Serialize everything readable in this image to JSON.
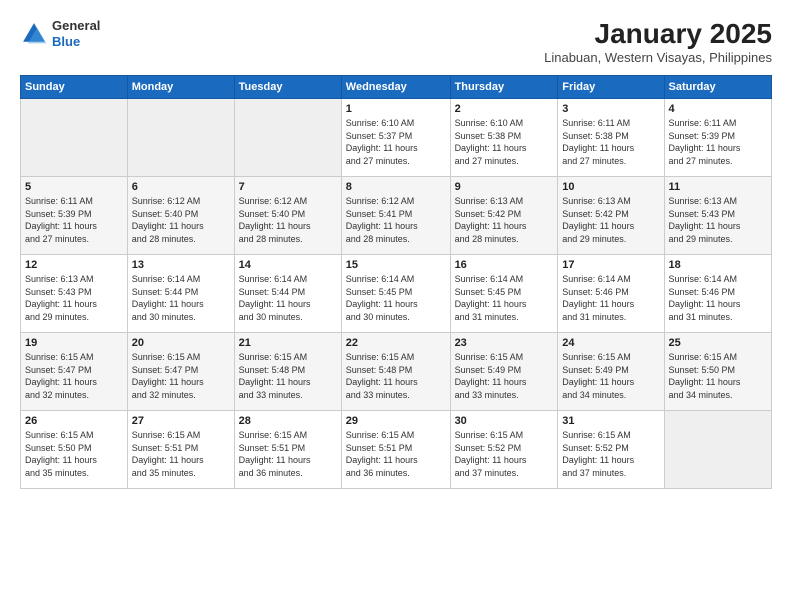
{
  "header": {
    "logo_general": "General",
    "logo_blue": "Blue",
    "month_title": "January 2025",
    "location": "Linabuan, Western Visayas, Philippines"
  },
  "days_of_week": [
    "Sunday",
    "Monday",
    "Tuesday",
    "Wednesday",
    "Thursday",
    "Friday",
    "Saturday"
  ],
  "weeks": [
    [
      {
        "day": "",
        "info": ""
      },
      {
        "day": "",
        "info": ""
      },
      {
        "day": "",
        "info": ""
      },
      {
        "day": "1",
        "info": "Sunrise: 6:10 AM\nSunset: 5:37 PM\nDaylight: 11 hours\nand 27 minutes."
      },
      {
        "day": "2",
        "info": "Sunrise: 6:10 AM\nSunset: 5:38 PM\nDaylight: 11 hours\nand 27 minutes."
      },
      {
        "day": "3",
        "info": "Sunrise: 6:11 AM\nSunset: 5:38 PM\nDaylight: 11 hours\nand 27 minutes."
      },
      {
        "day": "4",
        "info": "Sunrise: 6:11 AM\nSunset: 5:39 PM\nDaylight: 11 hours\nand 27 minutes."
      }
    ],
    [
      {
        "day": "5",
        "info": "Sunrise: 6:11 AM\nSunset: 5:39 PM\nDaylight: 11 hours\nand 27 minutes."
      },
      {
        "day": "6",
        "info": "Sunrise: 6:12 AM\nSunset: 5:40 PM\nDaylight: 11 hours\nand 28 minutes."
      },
      {
        "day": "7",
        "info": "Sunrise: 6:12 AM\nSunset: 5:40 PM\nDaylight: 11 hours\nand 28 minutes."
      },
      {
        "day": "8",
        "info": "Sunrise: 6:12 AM\nSunset: 5:41 PM\nDaylight: 11 hours\nand 28 minutes."
      },
      {
        "day": "9",
        "info": "Sunrise: 6:13 AM\nSunset: 5:42 PM\nDaylight: 11 hours\nand 28 minutes."
      },
      {
        "day": "10",
        "info": "Sunrise: 6:13 AM\nSunset: 5:42 PM\nDaylight: 11 hours\nand 29 minutes."
      },
      {
        "day": "11",
        "info": "Sunrise: 6:13 AM\nSunset: 5:43 PM\nDaylight: 11 hours\nand 29 minutes."
      }
    ],
    [
      {
        "day": "12",
        "info": "Sunrise: 6:13 AM\nSunset: 5:43 PM\nDaylight: 11 hours\nand 29 minutes."
      },
      {
        "day": "13",
        "info": "Sunrise: 6:14 AM\nSunset: 5:44 PM\nDaylight: 11 hours\nand 30 minutes."
      },
      {
        "day": "14",
        "info": "Sunrise: 6:14 AM\nSunset: 5:44 PM\nDaylight: 11 hours\nand 30 minutes."
      },
      {
        "day": "15",
        "info": "Sunrise: 6:14 AM\nSunset: 5:45 PM\nDaylight: 11 hours\nand 30 minutes."
      },
      {
        "day": "16",
        "info": "Sunrise: 6:14 AM\nSunset: 5:45 PM\nDaylight: 11 hours\nand 31 minutes."
      },
      {
        "day": "17",
        "info": "Sunrise: 6:14 AM\nSunset: 5:46 PM\nDaylight: 11 hours\nand 31 minutes."
      },
      {
        "day": "18",
        "info": "Sunrise: 6:14 AM\nSunset: 5:46 PM\nDaylight: 11 hours\nand 31 minutes."
      }
    ],
    [
      {
        "day": "19",
        "info": "Sunrise: 6:15 AM\nSunset: 5:47 PM\nDaylight: 11 hours\nand 32 minutes."
      },
      {
        "day": "20",
        "info": "Sunrise: 6:15 AM\nSunset: 5:47 PM\nDaylight: 11 hours\nand 32 minutes."
      },
      {
        "day": "21",
        "info": "Sunrise: 6:15 AM\nSunset: 5:48 PM\nDaylight: 11 hours\nand 33 minutes."
      },
      {
        "day": "22",
        "info": "Sunrise: 6:15 AM\nSunset: 5:48 PM\nDaylight: 11 hours\nand 33 minutes."
      },
      {
        "day": "23",
        "info": "Sunrise: 6:15 AM\nSunset: 5:49 PM\nDaylight: 11 hours\nand 33 minutes."
      },
      {
        "day": "24",
        "info": "Sunrise: 6:15 AM\nSunset: 5:49 PM\nDaylight: 11 hours\nand 34 minutes."
      },
      {
        "day": "25",
        "info": "Sunrise: 6:15 AM\nSunset: 5:50 PM\nDaylight: 11 hours\nand 34 minutes."
      }
    ],
    [
      {
        "day": "26",
        "info": "Sunrise: 6:15 AM\nSunset: 5:50 PM\nDaylight: 11 hours\nand 35 minutes."
      },
      {
        "day": "27",
        "info": "Sunrise: 6:15 AM\nSunset: 5:51 PM\nDaylight: 11 hours\nand 35 minutes."
      },
      {
        "day": "28",
        "info": "Sunrise: 6:15 AM\nSunset: 5:51 PM\nDaylight: 11 hours\nand 36 minutes."
      },
      {
        "day": "29",
        "info": "Sunrise: 6:15 AM\nSunset: 5:51 PM\nDaylight: 11 hours\nand 36 minutes."
      },
      {
        "day": "30",
        "info": "Sunrise: 6:15 AM\nSunset: 5:52 PM\nDaylight: 11 hours\nand 37 minutes."
      },
      {
        "day": "31",
        "info": "Sunrise: 6:15 AM\nSunset: 5:52 PM\nDaylight: 11 hours\nand 37 minutes."
      },
      {
        "day": "",
        "info": ""
      }
    ]
  ]
}
